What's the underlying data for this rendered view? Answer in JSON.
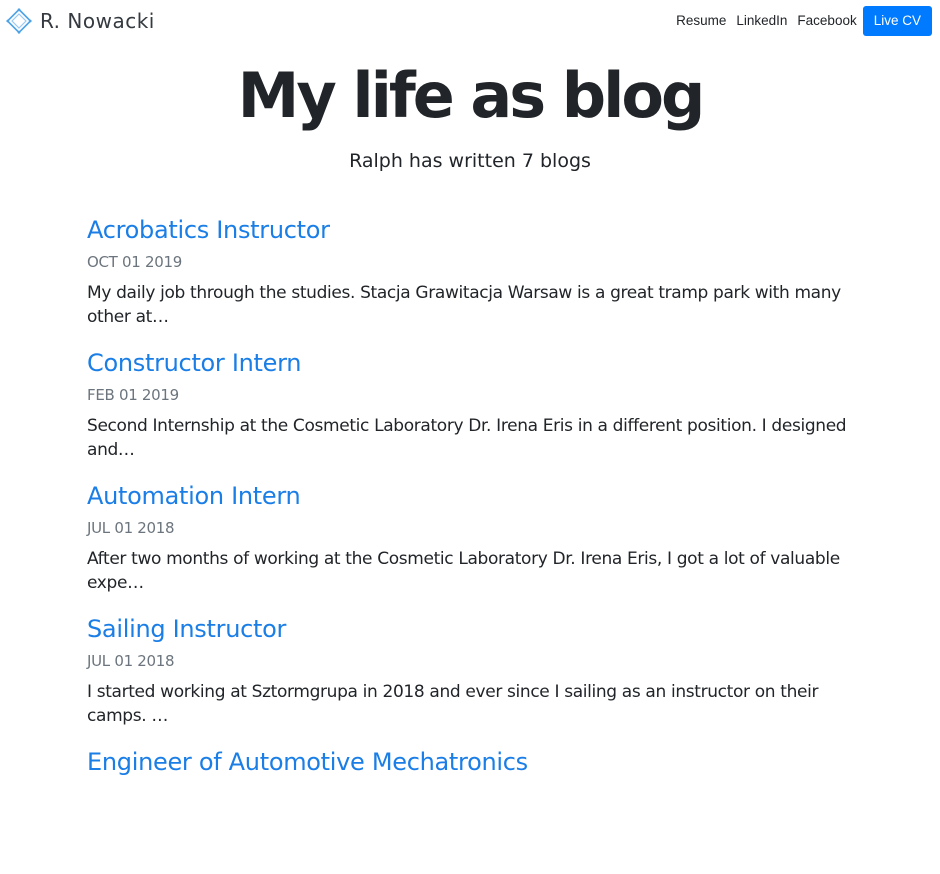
{
  "brand": {
    "name": "R. Nowacki",
    "logo_icon": "diamond-logo-icon",
    "logo_color": "#4da3e6"
  },
  "nav": {
    "links": [
      "Resume",
      "LinkedIn",
      "Facebook"
    ],
    "cta_label": "Live CV",
    "cta_color": "#007bff"
  },
  "hero": {
    "title": "My life as blog",
    "subtitle": "Ralph has written 7 blogs"
  },
  "colors": {
    "link": "#1a7ee6",
    "date": "#6c757d",
    "text": "#212529"
  },
  "posts": [
    {
      "title": "Acrobatics Instructor",
      "date": "OCT 01 2019",
      "excerpt": "My daily job through the studies. Stacja Grawitacja Warsaw is a great tramp park with many other at…"
    },
    {
      "title": "Constructor Intern",
      "date": "FEB 01 2019",
      "excerpt": "Second Internship at the Cosmetic Laboratory Dr. Irena Eris in a different position. I designed and…"
    },
    {
      "title": "Automation Intern",
      "date": "JUL 01 2018",
      "excerpt": "After two months of working at the Cosmetic Laboratory Dr. Irena Eris, I got a lot of valuable expe…"
    },
    {
      "title": "Sailing Instructor",
      "date": "JUL 01 2018",
      "excerpt": "I started working at Sztormgrupa in 2018 and ever since I sailing as an instructor on their camps. …"
    },
    {
      "title": "Engineer of Automotive Mechatronics",
      "date": "",
      "excerpt": ""
    }
  ]
}
